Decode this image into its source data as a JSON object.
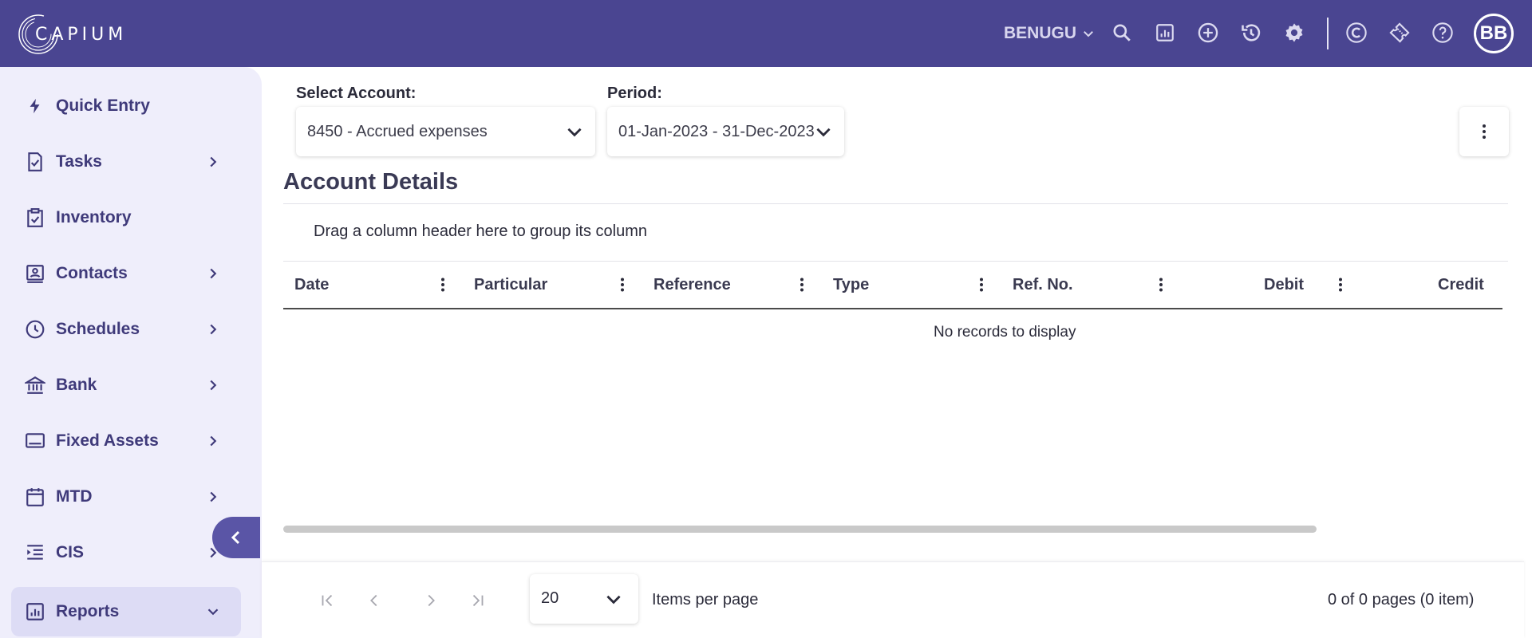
{
  "header": {
    "logo_text": "CAPIUM",
    "org_name": "BENUGU",
    "avatar_initials": "BB",
    "icons": [
      "search-icon",
      "report-icon",
      "add-circle-icon",
      "history-icon",
      "settings-icon",
      "capium-c-icon",
      "ticket-icon",
      "help-icon"
    ]
  },
  "sidebar": {
    "items": [
      {
        "label": "Quick Entry",
        "icon": "bolt-icon",
        "has_submenu": false
      },
      {
        "label": "Tasks",
        "icon": "task-doc-icon",
        "has_submenu": true
      },
      {
        "label": "Inventory",
        "icon": "clipboard-check-icon",
        "has_submenu": false
      },
      {
        "label": "Contacts",
        "icon": "contact-card-icon",
        "has_submenu": true
      },
      {
        "label": "Schedules",
        "icon": "clock-icon",
        "has_submenu": true
      },
      {
        "label": "Bank",
        "icon": "bank-icon",
        "has_submenu": true
      },
      {
        "label": "Fixed Assets",
        "icon": "monitor-icon",
        "has_submenu": true
      },
      {
        "label": "MTD",
        "icon": "calendar-icon",
        "has_submenu": true
      },
      {
        "label": "CIS",
        "icon": "indent-list-icon",
        "has_submenu": true
      },
      {
        "label": "Reports",
        "icon": "bar-chart-icon",
        "has_submenu": true,
        "active": true
      }
    ]
  },
  "filters": {
    "account_label": "Select Account:",
    "account_value": "8450 - Accrued expenses",
    "period_label": "Period:",
    "period_value": "01-Jan-2023 - 31-Dec-2023"
  },
  "main": {
    "title": "Account Details",
    "group_hint": "Drag a column header here to group its column",
    "columns": [
      "Date",
      "Particular",
      "Reference",
      "Type",
      "Ref. No.",
      "Debit",
      "Credit"
    ],
    "empty_text": "No records to display"
  },
  "pager": {
    "page_size": "20",
    "items_per_page_label": "Items per page",
    "info": "0 of 0 pages (0 item)"
  },
  "colors": {
    "topbar": "#4a4591",
    "sidebar": "#efeefb",
    "accent": "#3f3a7a"
  }
}
